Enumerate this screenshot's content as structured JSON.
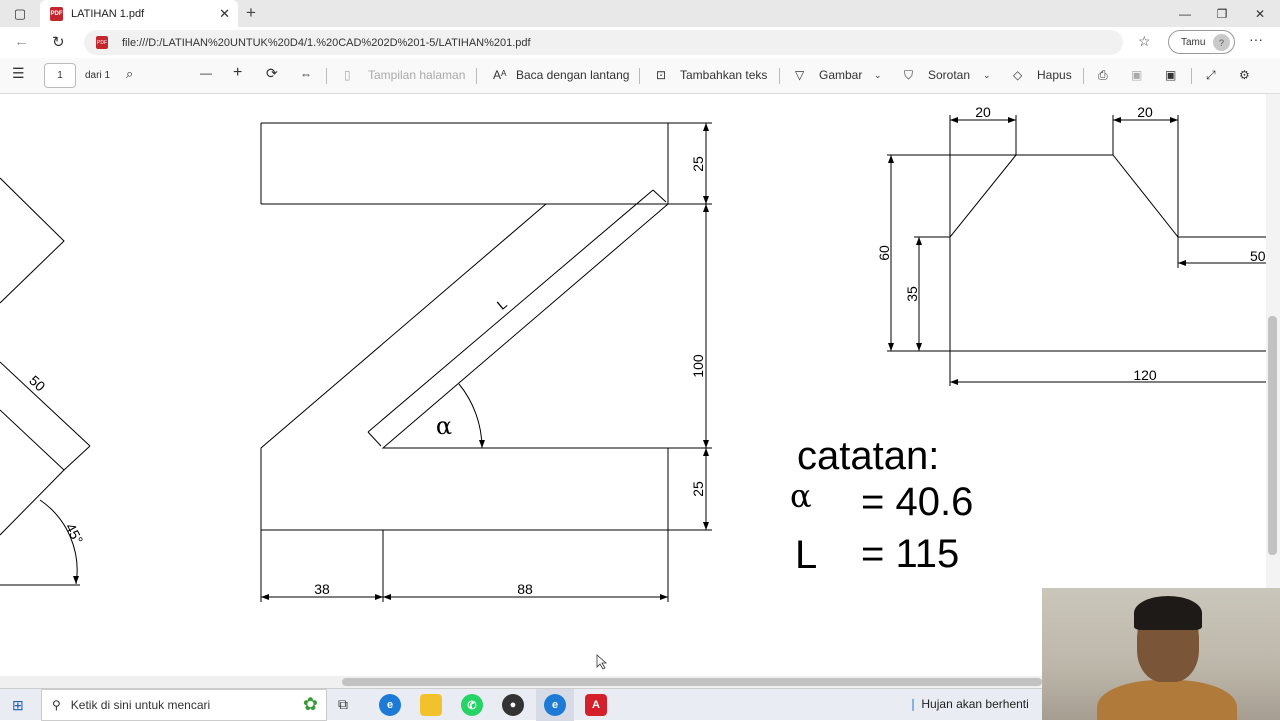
{
  "browser": {
    "tab_title": "LATIHAN 1.pdf",
    "tab_icon": "PDF",
    "new_tab": "+",
    "url": "file:///D:/LATIHAN%20UNTUK%20D4/1.%20CAD%202D%201-5/LATIHAN%201.pdf",
    "profile_label": "Tamu",
    "profile_avatar": "?"
  },
  "pdf_toolbar": {
    "page_current": "1",
    "page_of": "dari 1",
    "view_label": "Tampilan halaman",
    "read_aloud_label": "Baca dengan lantang",
    "add_text_label": "Tambahkan teks",
    "draw_label": "Gambar",
    "highlight_label": "Sorotan",
    "erase_label": "Hapus"
  },
  "drawing": {
    "main_dims": {
      "d25_top": "25",
      "d100": "100",
      "d25_bottom": "25",
      "d38": "38",
      "d88": "88",
      "L": "L",
      "alpha": "α"
    },
    "right_dims": {
      "d20_left": "20",
      "d20_right": "20",
      "d60": "60",
      "d35": "35",
      "d50": "50",
      "d120": "120"
    },
    "left_dims": {
      "d50": "50",
      "d45": "45°"
    },
    "notes": {
      "title": "catatan:",
      "alpha_symbol": "α",
      "alpha_value": "= 40.6",
      "L_symbol": "L",
      "L_value": "= 115"
    }
  },
  "taskbar": {
    "search_placeholder": "Ketik di sini untuk mencari",
    "weather_text": "Hujan akan berhenti"
  },
  "colors": {
    "pdf_red": "#c4262e",
    "edge_blue": "#1d7ad6",
    "acrobat_red": "#d4202a",
    "whatsapp_green": "#25d366",
    "explorer_yellow": "#f2c22e"
  }
}
